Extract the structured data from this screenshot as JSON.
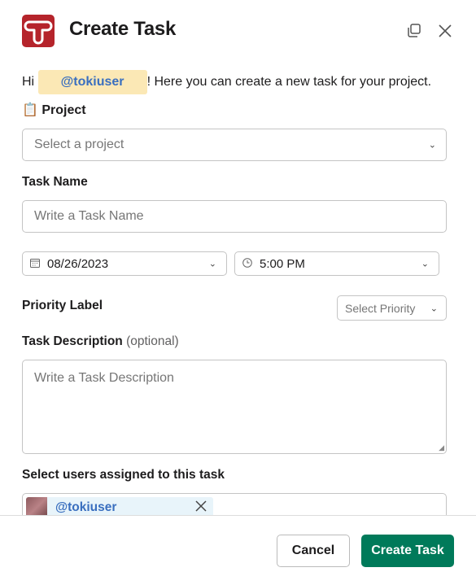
{
  "header": {
    "title": "Create Task",
    "logo_letter": "T",
    "icons": [
      "expand-icon",
      "close-icon"
    ]
  },
  "greeting": {
    "prefix": "Hi",
    "mention": "@tokiuser",
    "suffix": "! Here you can create a new task for your project."
  },
  "project": {
    "emoji": "📋",
    "label": "Project",
    "placeholder": "Select a project"
  },
  "task_name": {
    "label": "Task Name",
    "placeholder": "Write a Task Name"
  },
  "date": {
    "value": "08/26/2023"
  },
  "time": {
    "value": "5:00 PM"
  },
  "priority": {
    "label": "Priority Label",
    "placeholder": "Select Priority"
  },
  "description": {
    "label": "Task Description",
    "optional": "(optional)",
    "placeholder": "Write a Task Description"
  },
  "users": {
    "label": "Select users assigned to this task",
    "selected": [
      "@tokiuser"
    ]
  },
  "footer": {
    "cancel": "Cancel",
    "submit": "Create Task"
  },
  "colors": {
    "brand": "#b5242b",
    "primary": "#007a5a",
    "mention_bg": "#fbe8b5",
    "mention_text": "#3a6fbf"
  }
}
